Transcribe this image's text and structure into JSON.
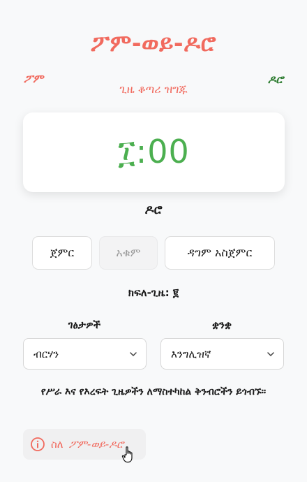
{
  "app": {
    "title": "ፖም-ወይ-ዶሮ",
    "subtitle": "ጊዜ ቆጣሪ ዝግጁ",
    "corner_left": "ፖም",
    "corner_right": "ዶሮ"
  },
  "timer": {
    "display": "፲:00",
    "mode": "ዶሮ"
  },
  "controls": {
    "start": "ጀምር",
    "stop": "አቁም",
    "restart": "ዳግም አስጀምር"
  },
  "session": {
    "text": "ክፍለ-ጊዜ: ፪"
  },
  "settings": {
    "themes_label": "ገፅታዎች",
    "themes_value": "ብርሃን",
    "language_label": "ቋንቋ",
    "language_value": "እንግሊዝኛ"
  },
  "info": {
    "text": "የሥራ እና የእረፍት ጊዜዎችን ለማስተካከል ቅንብሮችን ይጎብኙ።"
  },
  "about": {
    "prefix": "ስለ",
    "name": "ፖም-ወይ-ዶሮ"
  },
  "colors": {
    "accent": "#f16a5e",
    "timer": "#4caf50",
    "chicken": "#2f7d32"
  },
  "icons": {
    "info": "info-circle-icon",
    "chevron": "chevron-down-icon",
    "cursor": "hand-pointer-icon"
  }
}
